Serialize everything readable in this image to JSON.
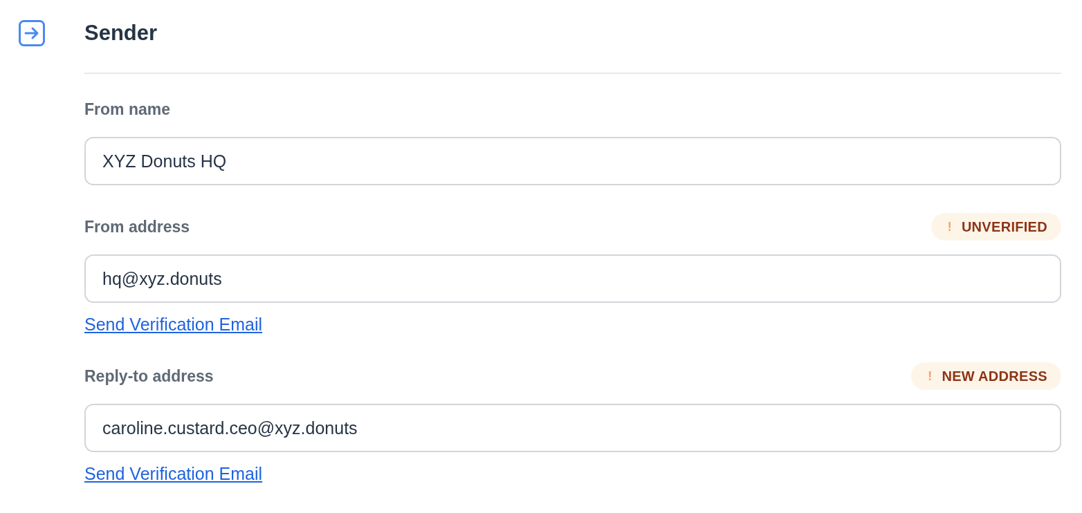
{
  "section": {
    "title": "Sender"
  },
  "fields": [
    {
      "label": "From name",
      "value": "XYZ Donuts HQ"
    },
    {
      "label": "From address",
      "badge": {
        "mark": "!",
        "text": "UNVERIFIED"
      },
      "value": "hq@xyz.donuts",
      "link": "Send Verification Email"
    },
    {
      "label": "Reply-to address",
      "badge": {
        "mark": "!",
        "text": "NEW ADDRESS"
      },
      "value": "caroline.custard.ceo@xyz.donuts",
      "link": "Send Verification Email"
    }
  ]
}
